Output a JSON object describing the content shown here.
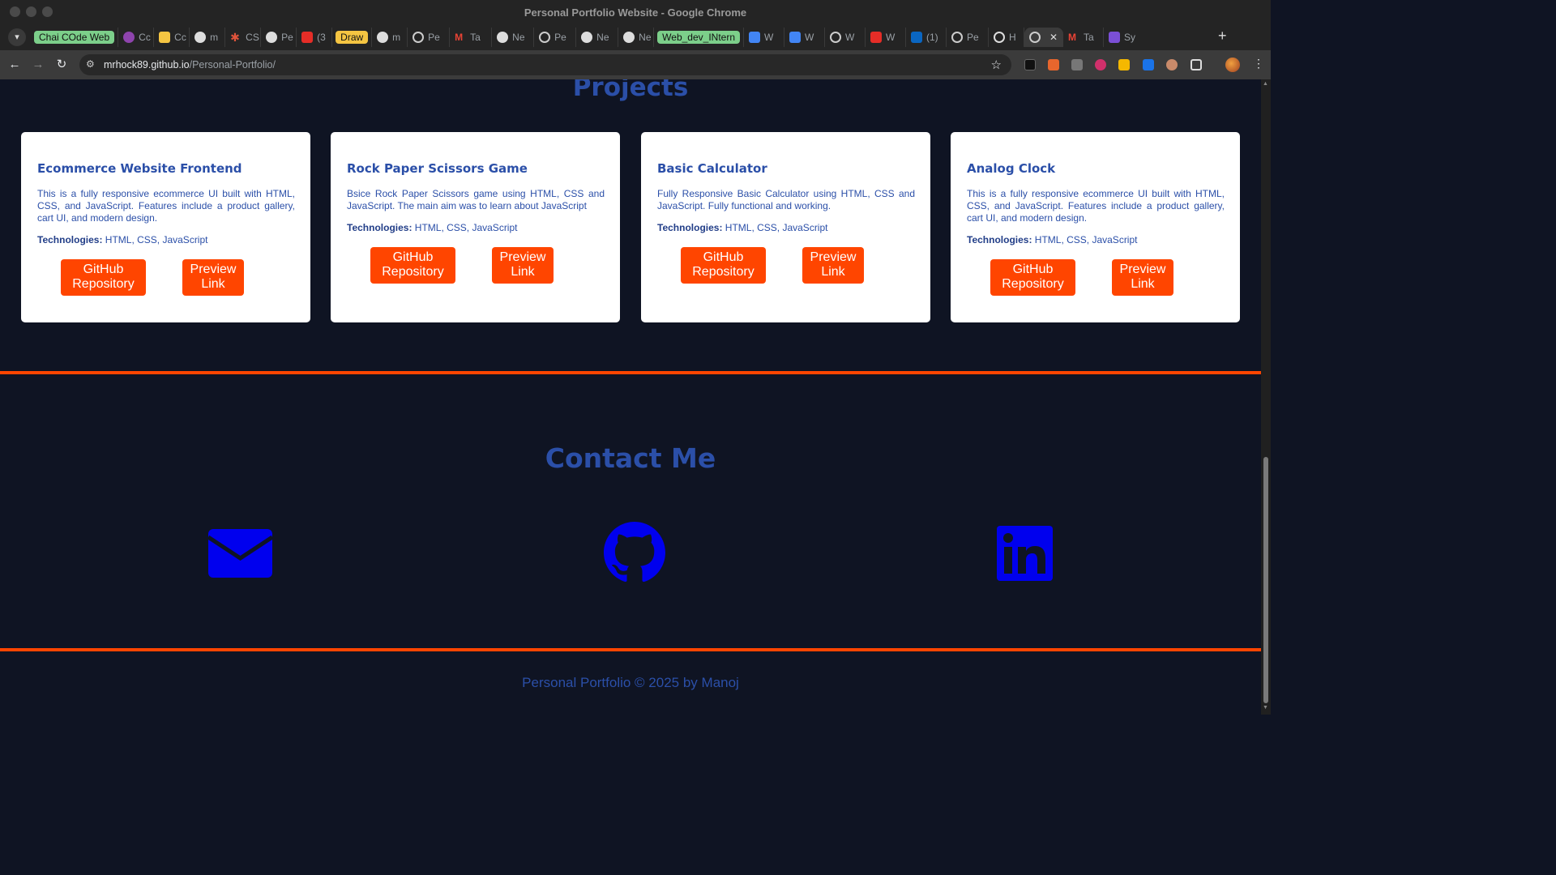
{
  "window": {
    "title": "Personal Portfolio Website - Google Chrome"
  },
  "tabs": [
    {
      "label": "Chai COde Web",
      "type": "group",
      "color": "#7ccf8a"
    },
    {
      "label": "Cc",
      "icon": "purple-circle-icon"
    },
    {
      "label": "Cc",
      "icon": "yellow-square-icon"
    },
    {
      "label": "m",
      "icon": "github-icon"
    },
    {
      "label": "CS",
      "icon": "asterisk-icon"
    },
    {
      "label": "Pe",
      "icon": "github-icon"
    },
    {
      "label": "(3",
      "icon": "youtube-icon"
    },
    {
      "label": "Draw",
      "type": "group",
      "color": "#f5c542"
    },
    {
      "label": "m",
      "icon": "github-icon"
    },
    {
      "label": "Pe",
      "icon": "globe-icon"
    },
    {
      "label": "Ta",
      "icon": "gmail-icon"
    },
    {
      "label": "Ne",
      "icon": "chrome-icon"
    },
    {
      "label": "Pe",
      "icon": "globe-icon"
    },
    {
      "label": "Ne",
      "icon": "chrome-icon"
    },
    {
      "label": "Ne",
      "icon": "chrome-icon"
    },
    {
      "label": "Web_dev_INtern",
      "type": "group",
      "color": "#7ccf8a"
    },
    {
      "label": "W",
      "icon": "docs-icon"
    },
    {
      "label": "W",
      "icon": "docs-icon"
    },
    {
      "label": "W",
      "icon": "globe-icon"
    },
    {
      "label": "W",
      "icon": "youtube-icon"
    },
    {
      "label": "(1)",
      "icon": "linkedin-icon"
    },
    {
      "label": "Pe",
      "icon": "openai-icon"
    },
    {
      "label": "H",
      "icon": "circle-icon"
    },
    {
      "label": "",
      "icon": "globe-icon",
      "active": true
    },
    {
      "label": "Ta",
      "icon": "gmail-icon"
    },
    {
      "label": "Sy",
      "icon": "purple-list-icon"
    }
  ],
  "toolbar": {
    "url_host": "mrhock89.github.io",
    "url_path": "/Personal-Portfolio/"
  },
  "projects": {
    "title": "Projects",
    "cards": [
      {
        "title": "Ecommerce Website Frontend",
        "description": "This is a fully responsive ecommerce UI built with HTML, CSS, and JavaScript. Features include a product gallery, cart UI, and modern design.",
        "tech_label": "Technologies:",
        "tech": " HTML, CSS, JavaScript",
        "github_label": "GitHub Repository",
        "preview_label": "Preview Link"
      },
      {
        "title": "Rock Paper Scissors Game",
        "description": "Bsice Rock Paper Scissors game using HTML, CSS and JavaScript. The main aim was to learn about JavaScript",
        "tech_label": "Technologies:",
        "tech": " HTML, CSS, JavaScript",
        "github_label": "GitHub Repository",
        "preview_label": "Preview Link"
      },
      {
        "title": "Basic Calculator",
        "description": "Fully Responsive Basic Calculator using HTML, CSS and JavaScript. Fully functional and working.",
        "tech_label": "Technologies:",
        "tech": " HTML, CSS, JavaScript",
        "github_label": "GitHub Repository",
        "preview_label": "Preview Link"
      },
      {
        "title": "Analog Clock",
        "description": "This is a fully responsive ecommerce UI built with HTML, CSS, and JavaScript. Features include a product gallery, cart UI, and modern design.",
        "tech_label": "Technologies:",
        "tech": " HTML, CSS, JavaScript",
        "github_label": "GitHub Repository",
        "preview_label": "Preview Link"
      }
    ]
  },
  "contact": {
    "title": "Contact Me",
    "icons": [
      "envelope-icon",
      "github-icon",
      "linkedin-icon"
    ],
    "icon_color": "#0000ee"
  },
  "footer": {
    "text": "Personal Portfolio © 2025 by Manoj"
  },
  "colors": {
    "background": "#0f1423",
    "accent": "#ff4500",
    "heading": "#2b4fa8"
  }
}
